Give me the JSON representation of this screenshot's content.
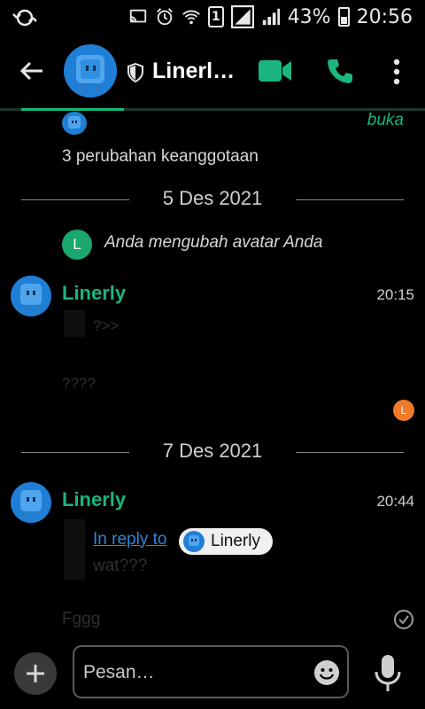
{
  "status_bar": {
    "battery_percent": "43%",
    "time": "20:56",
    "sim_slot": "1"
  },
  "header": {
    "title": "Linerl…"
  },
  "conversation": {
    "open_label": "buka",
    "membership_changes": "3 perubahan keanggotaan",
    "date_1": "5 Des 2021",
    "avatar_event_initial": "L",
    "avatar_event_text": "Anda mengubah avatar Anda",
    "msg1": {
      "sender": "Linerly",
      "time": "20:15",
      "quote": "?>>",
      "body": "????",
      "read_receipt_initial": "L"
    },
    "date_2": "7 Des 2021",
    "msg2": {
      "sender": "Linerly",
      "time": "20:44",
      "reply_to_label": "In reply to",
      "reply_to_name": "Linerly",
      "quoted": "wat???",
      "pending_body": "Fggg"
    }
  },
  "composer": {
    "placeholder": "Pesan…"
  },
  "colors": {
    "accent_green": "#1bb57d",
    "avatar_blue": "#1f7fd6",
    "read_receipt_orange": "#f07a2a"
  }
}
